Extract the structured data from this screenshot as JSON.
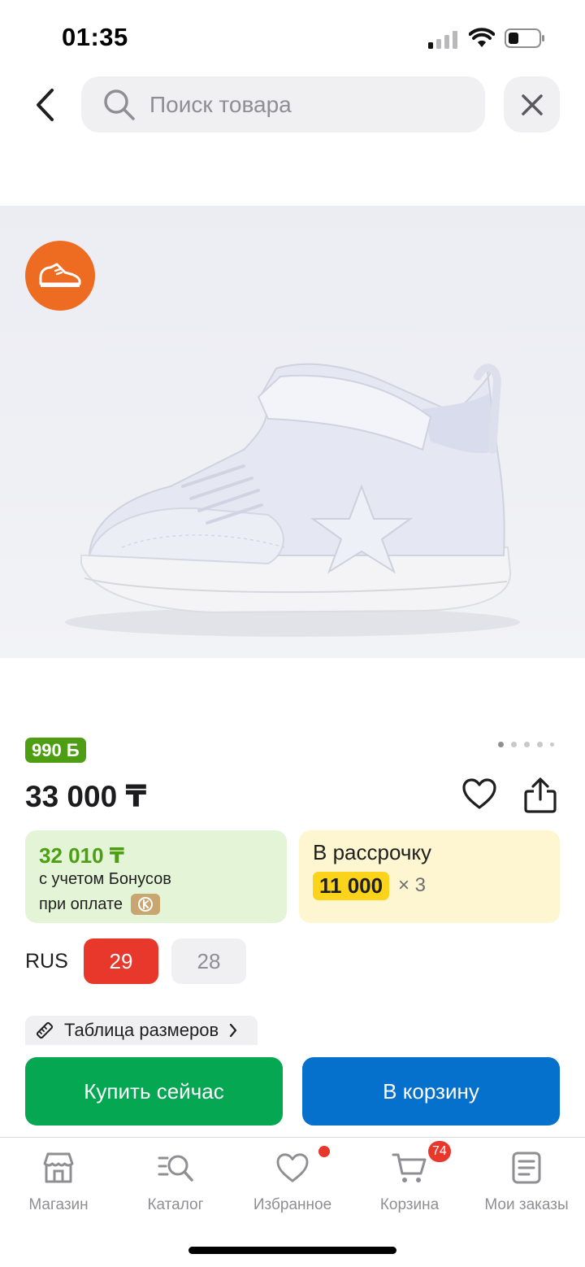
{
  "status_bar": {
    "time": "01:35"
  },
  "search": {
    "placeholder": "Поиск товара"
  },
  "product": {
    "bonus_badge": "990 Б",
    "price": "33 000 ₸",
    "gallery_pages": 5,
    "gallery_active_index": 0
  },
  "bonus_card": {
    "amount": "32 010 ₸",
    "line1": "с учетом Бонусов",
    "line2": "при оплате"
  },
  "installment_card": {
    "title": "В рассрочку",
    "monthly": "11 000",
    "times": "× 3"
  },
  "sizes": {
    "label": "RUS",
    "options": [
      "29",
      "28"
    ],
    "selected": "29"
  },
  "size_table_label": "Таблица размеров",
  "actions": {
    "buy_now": "Купить сейчас",
    "add_to_cart": "В корзину"
  },
  "tabbar": {
    "items": [
      {
        "label": "Магазин",
        "icon": "shop-icon"
      },
      {
        "label": "Каталог",
        "icon": "catalog-icon"
      },
      {
        "label": "Избранное",
        "icon": "heart-icon"
      },
      {
        "label": "Корзина",
        "icon": "cart-icon"
      },
      {
        "label": "Мои заказы",
        "icon": "orders-icon"
      }
    ],
    "cart_count": "74"
  },
  "colors": {
    "brand_red": "#e8372b",
    "buy_green": "#06a752",
    "cart_blue": "#0671cc",
    "bonus_green": "#4e9e14",
    "installment_yellow": "#fbd31b",
    "category_orange": "#ee6b22"
  }
}
